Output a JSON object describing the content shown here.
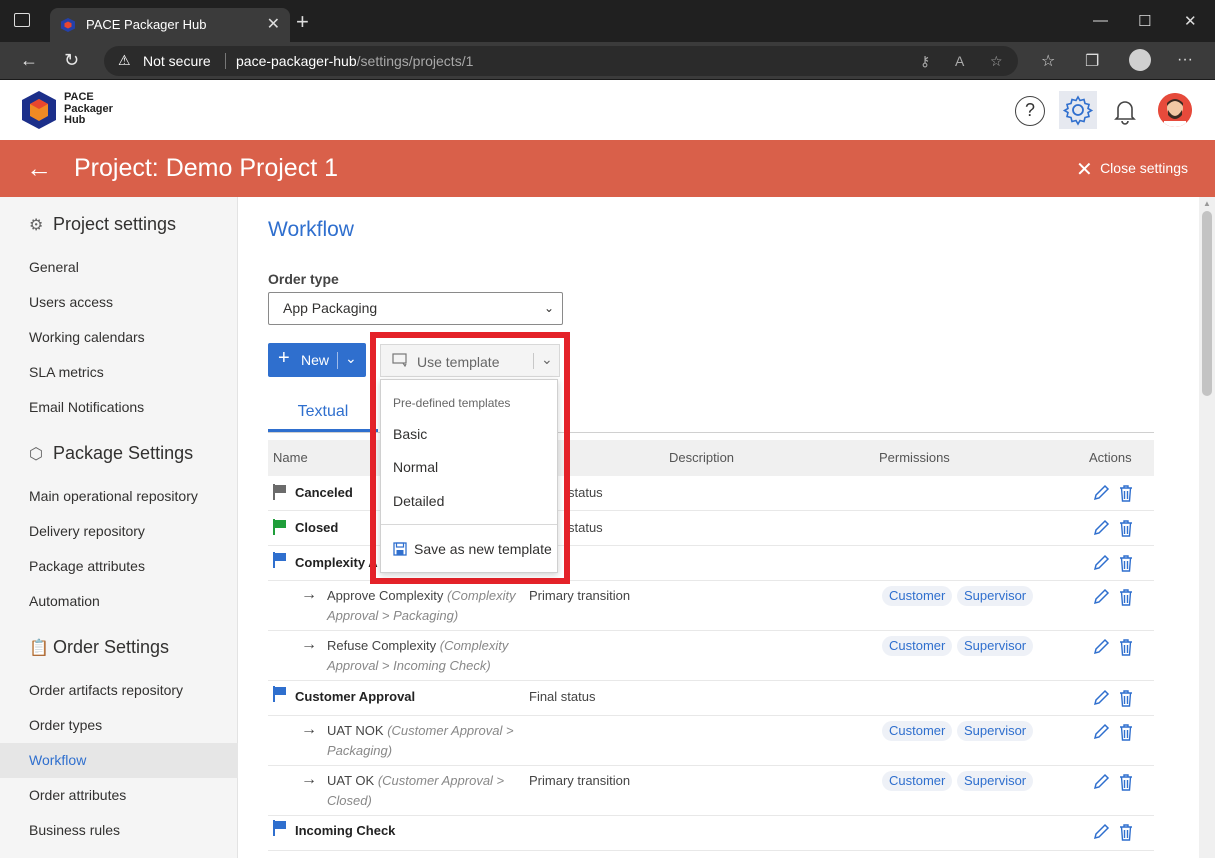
{
  "browser": {
    "tab_title": "PACE Packager Hub",
    "tab_close": "✕",
    "new_tab": "+",
    "security_label": "Not secure",
    "url_host": "pace-packager-hub",
    "url_path": "/settings/projects/1",
    "window_minimize": "—",
    "window_maximize": "☐",
    "window_close": "✕",
    "more": "···"
  },
  "app": {
    "logo_text": "PACE Packager Hub",
    "help_glyph": "?"
  },
  "banner": {
    "title": "Project: Demo Project 1",
    "close_label": "Close settings"
  },
  "sidebar": {
    "project_settings": {
      "title": "Project settings",
      "icon": "gear-icon",
      "items": [
        "General",
        "Users access",
        "Working calendars",
        "SLA metrics",
        "Email Notifications"
      ]
    },
    "package_settings": {
      "title": "Package Settings",
      "icon": "cube-icon",
      "items": [
        "Main operational repository",
        "Delivery repository",
        "Package attributes",
        "Automation"
      ]
    },
    "order_settings": {
      "title": "Order Settings",
      "icon": "clipboard-icon",
      "items": [
        "Order artifacts repository",
        "Order types",
        "Workflow",
        "Order attributes",
        "Business rules"
      ]
    },
    "active_item": "Workflow"
  },
  "main": {
    "title": "Workflow",
    "order_type_label": "Order type",
    "order_type_value": "App Packaging",
    "new_button": "New",
    "use_template_button": "Use template",
    "tab_textual": "Textual",
    "columns": [
      "Name",
      "Description",
      "Permissions",
      "Actions"
    ],
    "rows": [
      {
        "kind": "status",
        "flag": "gray",
        "name": "Canceled",
        "description": "status"
      },
      {
        "kind": "status",
        "flag": "green",
        "name": "Closed",
        "description": "status"
      },
      {
        "kind": "status",
        "flag": "blue",
        "name": "Complexity A",
        "description": ""
      },
      {
        "kind": "transition",
        "name": "Approve Complexity",
        "detail_1": "(Complexity",
        "detail_2": "Approval > Packaging)",
        "description": "Primary transition",
        "permissions": [
          "Customer",
          "Supervisor"
        ]
      },
      {
        "kind": "transition",
        "name": "Refuse Complexity",
        "detail_1": "(Complexity",
        "detail_2": "Approval > Incoming Check)",
        "description": "",
        "permissions": [
          "Customer",
          "Supervisor"
        ]
      },
      {
        "kind": "status",
        "flag": "blue",
        "name": "Customer Approval",
        "description": "Final status"
      },
      {
        "kind": "transition",
        "name": "UAT NOK",
        "detail_1": "(Customer Approval >",
        "detail_2": "Packaging)",
        "description": "",
        "permissions": [
          "Customer",
          "Supervisor"
        ]
      },
      {
        "kind": "transition",
        "name": "UAT OK",
        "detail_1": "(Customer Approval >",
        "detail_2": "Closed)",
        "description": "Primary transition",
        "permissions": [
          "Customer",
          "Supervisor"
        ]
      },
      {
        "kind": "status",
        "flag": "blue",
        "name": "Incoming Check",
        "description": ""
      }
    ]
  },
  "template_menu": {
    "group_label": "Pre-defined templates",
    "items": [
      "Basic",
      "Normal",
      "Detailed"
    ],
    "save_label": "Save as new template"
  },
  "colors": {
    "accent": "#2f6fce",
    "banner": "#d9604a",
    "highlight": "#e42229",
    "flag_gray": "#6b6b6b",
    "flag_green": "#1f9e3a",
    "flag_blue": "#2f6fce"
  }
}
